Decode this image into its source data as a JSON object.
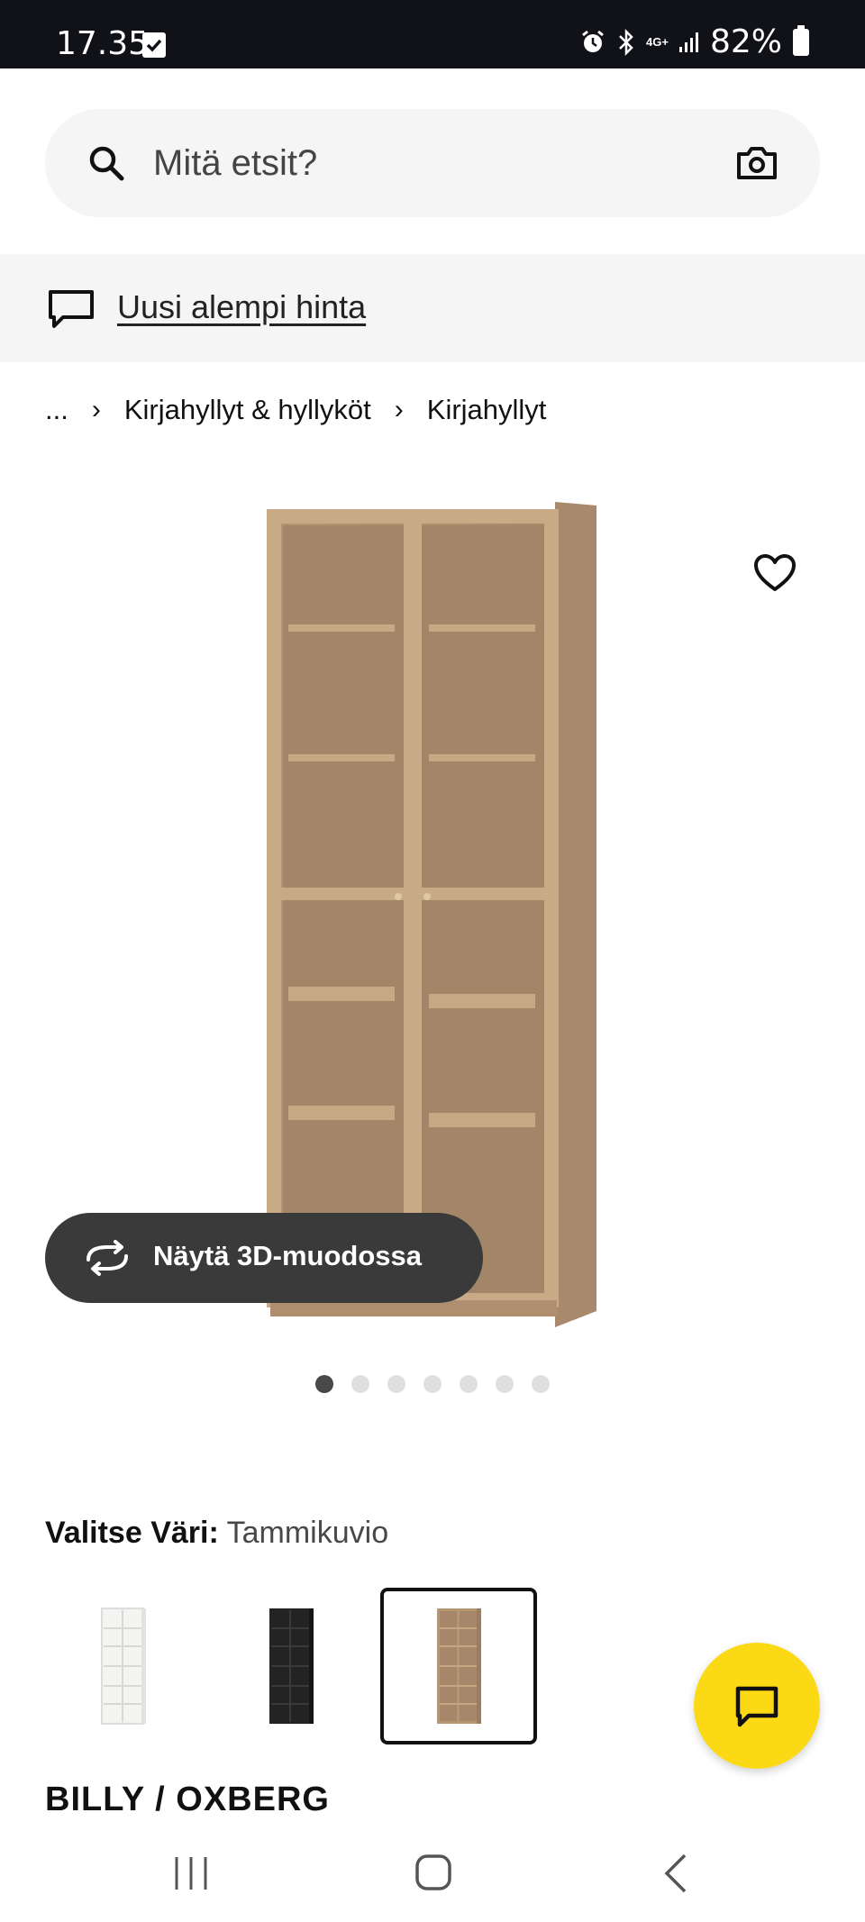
{
  "status_bar": {
    "time": "17.35",
    "network": "4G+",
    "battery": "82%"
  },
  "search": {
    "placeholder": "Mitä etsit?"
  },
  "banner": {
    "link_text": "Uusi alempi hinta"
  },
  "breadcrumb": {
    "ellipsis": "...",
    "items": [
      "Kirjahyllyt & hyllyköt",
      "Kirjahyllyt"
    ]
  },
  "product": {
    "view_3d_label": "Näytä 3D-muodossa",
    "image_dots_total": 7,
    "image_dots_active": 1,
    "color_label": "Valitse Väri:",
    "color_value": "Tammikuvio",
    "swatches": [
      "white",
      "black",
      "oak"
    ],
    "selected_swatch": 2,
    "name": "BILLY / OXBERG"
  },
  "colors": {
    "accent_yellow": "#fbd914",
    "wood": "#b79672",
    "dark_button": "#3a3a3a"
  }
}
